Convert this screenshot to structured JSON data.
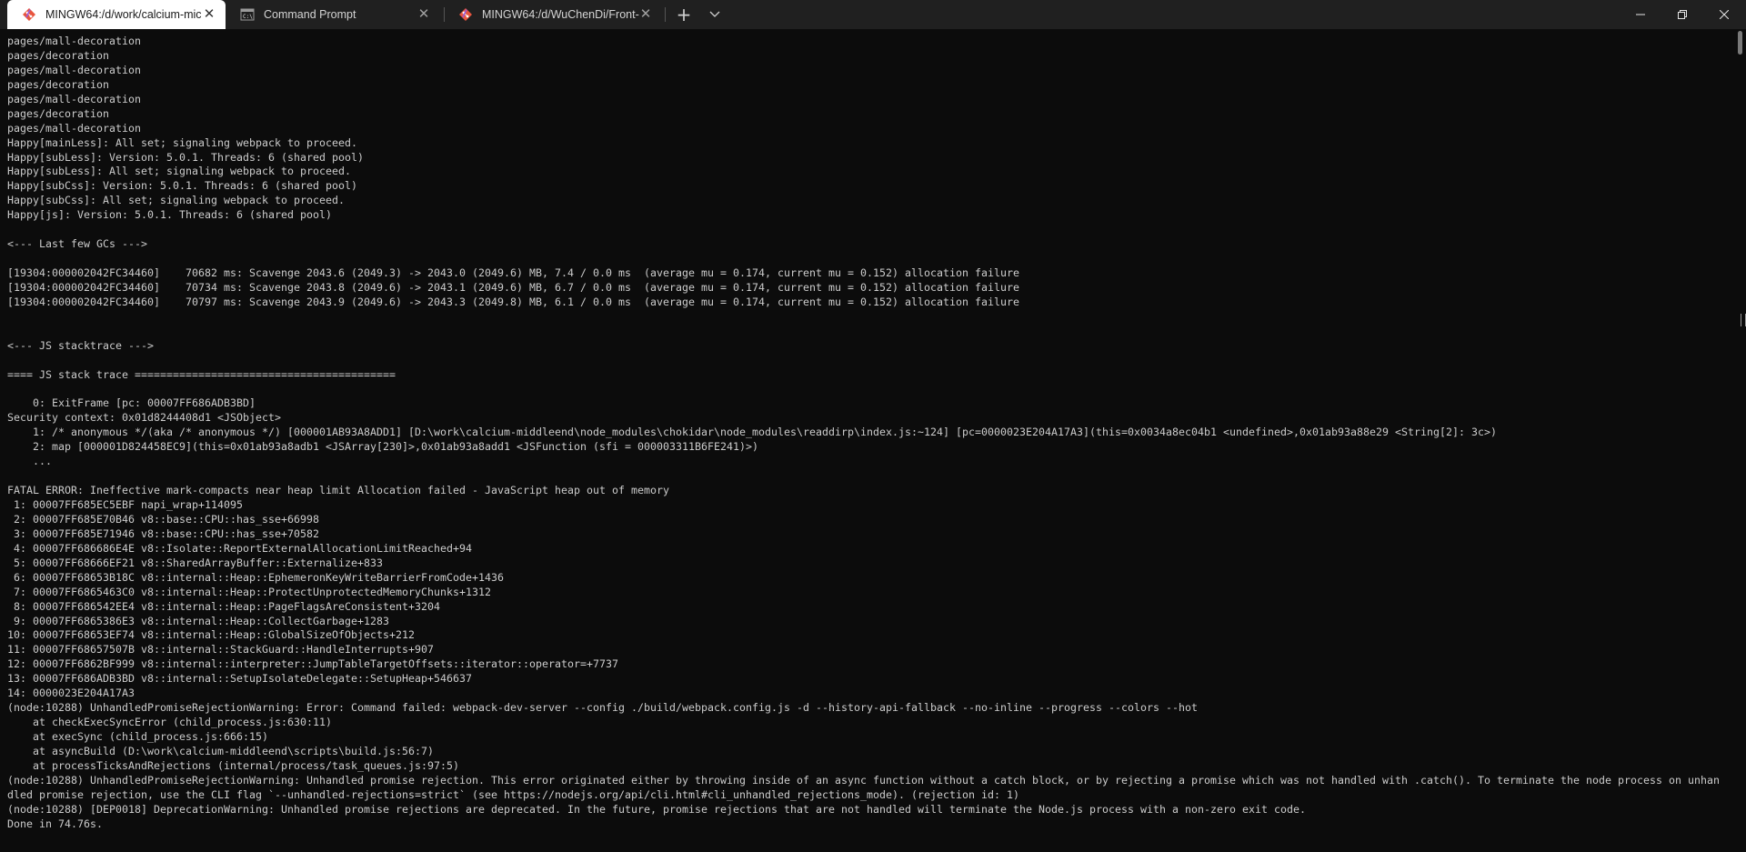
{
  "window": {
    "tabs": [
      {
        "title": "MINGW64:/d/work/calcium-mic",
        "icon": "git-bash-icon",
        "active": true
      },
      {
        "title": "Command Prompt",
        "icon": "cmd-icon",
        "active": false
      },
      {
        "title": "MINGW64:/d/WuChenDi/Front-",
        "icon": "git-bash-icon",
        "active": false
      }
    ],
    "close_glyph": "✕",
    "new_tab_glyph": "+",
    "dropdown_glyph": "⌄"
  },
  "terminal": {
    "lines": [
      "pages/mall-decoration",
      "pages/decoration",
      "pages/mall-decoration",
      "pages/decoration",
      "pages/mall-decoration",
      "pages/decoration",
      "pages/mall-decoration",
      "Happy[mainLess]: All set; signaling webpack to proceed.",
      "Happy[subLess]: Version: 5.0.1. Threads: 6 (shared pool)",
      "Happy[subLess]: All set; signaling webpack to proceed.",
      "Happy[subCss]: Version: 5.0.1. Threads: 6 (shared pool)",
      "Happy[subCss]: All set; signaling webpack to proceed.",
      "Happy[js]: Version: 5.0.1. Threads: 6 (shared pool)",
      "",
      "<--- Last few GCs --->",
      "",
      "[19304:000002042FC34460]    70682 ms: Scavenge 2043.6 (2049.3) -> 2043.0 (2049.6) MB, 7.4 / 0.0 ms  (average mu = 0.174, current mu = 0.152) allocation failure",
      "[19304:000002042FC34460]    70734 ms: Scavenge 2043.8 (2049.6) -> 2043.1 (2049.6) MB, 6.7 / 0.0 ms  (average mu = 0.174, current mu = 0.152) allocation failure",
      "[19304:000002042FC34460]    70797 ms: Scavenge 2043.9 (2049.6) -> 2043.3 (2049.8) MB, 6.1 / 0.0 ms  (average mu = 0.174, current mu = 0.152) allocation failure",
      "",
      "",
      "<--- JS stacktrace --->",
      "",
      "==== JS stack trace =========================================",
      "",
      "    0: ExitFrame [pc: 00007FF686ADB3BD]",
      "Security context: 0x01d8244408d1 <JSObject>",
      "    1: /* anonymous */(aka /* anonymous */) [000001AB93A8ADD1] [D:\\work\\calcium-middleend\\node_modules\\chokidar\\node_modules\\readdirp\\index.js:~124] [pc=0000023E204A17A3](this=0x0034a8ec04b1 <undefined>,0x01ab93a88e29 <String[2]: 3c>)",
      "    2: map [000001D824458EC9](this=0x01ab93a8adb1 <JSArray[230]>,0x01ab93a8add1 <JSFunction (sfi = 000003311B6FE241)>)",
      "    ...",
      "",
      "FATAL ERROR: Ineffective mark-compacts near heap limit Allocation failed - JavaScript heap out of memory",
      " 1: 00007FF685EC5EBF napi_wrap+114095",
      " 2: 00007FF685E70B46 v8::base::CPU::has_sse+66998",
      " 3: 00007FF685E71946 v8::base::CPU::has_sse+70582",
      " 4: 00007FF686686E4E v8::Isolate::ReportExternalAllocationLimitReached+94",
      " 5: 00007FF68666EF21 v8::SharedArrayBuffer::Externalize+833",
      " 6: 00007FF68653B18C v8::internal::Heap::EphemeronKeyWriteBarrierFromCode+1436",
      " 7: 00007FF6865463C0 v8::internal::Heap::ProtectUnprotectedMemoryChunks+1312",
      " 8: 00007FF686542EE4 v8::internal::Heap::PageFlagsAreConsistent+3204",
      " 9: 00007FF6865386E3 v8::internal::Heap::CollectGarbage+1283",
      "10: 00007FF68653EF74 v8::internal::Heap::GlobalSizeOfObjects+212",
      "11: 00007FF68657507B v8::internal::StackGuard::HandleInterrupts+907",
      "12: 00007FF6862BF999 v8::internal::interpreter::JumpTableTargetOffsets::iterator::operator=+7737",
      "13: 00007FF686ADB3BD v8::internal::SetupIsolateDelegate::SetupHeap+546637",
      "14: 0000023E204A17A3",
      "(node:10288) UnhandledPromiseRejectionWarning: Error: Command failed: webpack-dev-server --config ./build/webpack.config.js -d --history-api-fallback --no-inline --progress --colors --hot",
      "    at checkExecSyncError (child_process.js:630:11)",
      "    at execSync (child_process.js:666:15)",
      "    at asyncBuild (D:\\work\\calcium-middleend\\scripts\\build.js:56:7)",
      "    at processTicksAndRejections (internal/process/task_queues.js:97:5)",
      "(node:10288) UnhandledPromiseRejectionWarning: Unhandled promise rejection. This error originated either by throwing inside of an async function without a catch block, or by rejecting a promise which was not handled with .catch(). To terminate the node process on unhan",
      "dled promise rejection, use the CLI flag `--unhandled-rejections=strict` (see https://nodejs.org/api/cli.html#cli_unhandled_rejections_mode). (rejection id: 1)",
      "(node:10288) [DEP0018] DeprecationWarning: Unhandled promise rejections are deprecated. In the future, promise rejections that are not handled will terminate the Node.js process with a non-zero exit code.",
      "Done in 74.76s."
    ]
  }
}
